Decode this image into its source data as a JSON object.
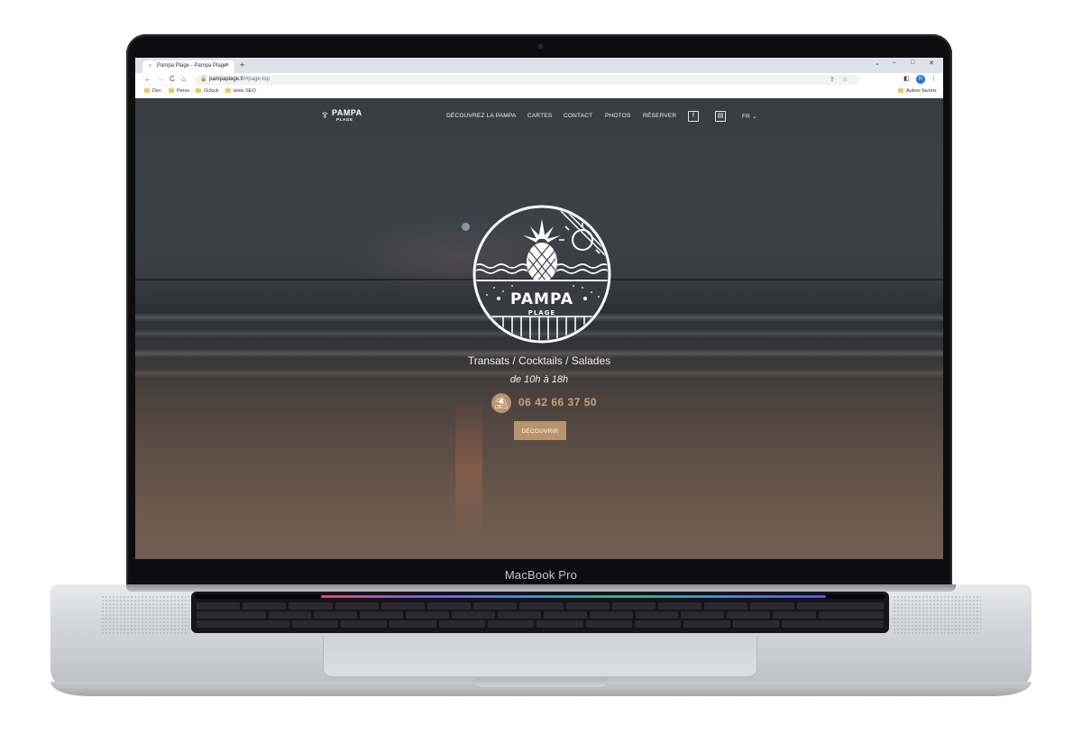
{
  "device": {
    "model_label": "MacBook Pro"
  },
  "browser": {
    "tab": {
      "title": "Pampa Plage - Pampa Plage",
      "close_glyph": "×"
    },
    "new_tab_glyph": "+",
    "window_controls": {
      "chevron": "⌄",
      "minimize": "–",
      "maximize": "□",
      "close": "✕"
    },
    "nav": {
      "back": "←",
      "forward": "→",
      "reload": "C",
      "home": "⌂"
    },
    "address": {
      "domain": "pampaplage.fr",
      "path": "/#page-top"
    },
    "bookmarks": [
      "Dev",
      "Perso",
      "Oclock",
      "tests SEO"
    ],
    "bookmarks_right": "Autres favoris",
    "profile_initial": "R"
  },
  "site": {
    "logo": {
      "brand": "PAMPA",
      "sub": "PLAGE"
    },
    "menu": [
      "DÉCOUVREZ LA PAMPA",
      "CARTES",
      "CONTACT",
      "PHOTOS",
      "RÉSERVER"
    ],
    "social": {
      "facebook": "f",
      "calendar": "▤"
    },
    "language": "FR ⌄",
    "emblem": {
      "brand": "PAMPA",
      "sub": "PLAGE"
    },
    "tagline": "Transats / Cocktails / Salades",
    "hours": "de 10h à 18h",
    "phone": "06 42 66 37 50",
    "cta": "DÉCOUVRIR"
  },
  "colors": {
    "accent": "#b8946a",
    "phone_text": "#c9a27a"
  }
}
